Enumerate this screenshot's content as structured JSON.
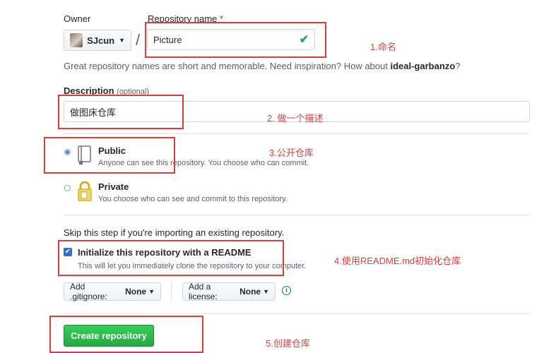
{
  "owner": {
    "label": "Owner",
    "name": "SJcun"
  },
  "repo": {
    "label": "Repository name",
    "required_mark": "*",
    "value": "Picture",
    "valid_icon": "check-icon"
  },
  "hint": {
    "text": "Great repository names are short and memorable. Need inspiration? How about ",
    "suggestion": "ideal-garbanzo",
    "end": "?"
  },
  "description": {
    "label": "Description",
    "optional": "(optional)",
    "value": "做图床仓库"
  },
  "visibility": {
    "public": {
      "title": "Public",
      "desc": "Anyone can see this repository. You choose who can commit.",
      "selected": true,
      "icon": "repo-icon"
    },
    "private": {
      "title": "Private",
      "desc": "You choose who can see and commit to this repository.",
      "selected": false,
      "icon": "lock-icon"
    }
  },
  "skip_text": "Skip this step if you're importing an existing repository.",
  "readme": {
    "title": "Initialize this repository with a README",
    "desc": "This will let you immediately clone the repository to your computer.",
    "checked": true
  },
  "gitignore": {
    "label": "Add .gitignore:",
    "value": "None"
  },
  "license": {
    "label": "Add a license:",
    "value": "None"
  },
  "create_label": "Create repository",
  "annotations": {
    "a1": "1.命名",
    "a2": "2. 做一个描述",
    "a3": "3.公开仓库",
    "a4": "4.使用README.md初始化仓库",
    "a5": "5.创建仓库"
  },
  "colors": {
    "accent_green": "#28a745",
    "annotation_red": "#e03b3b",
    "link_blue": "#0366d6"
  }
}
